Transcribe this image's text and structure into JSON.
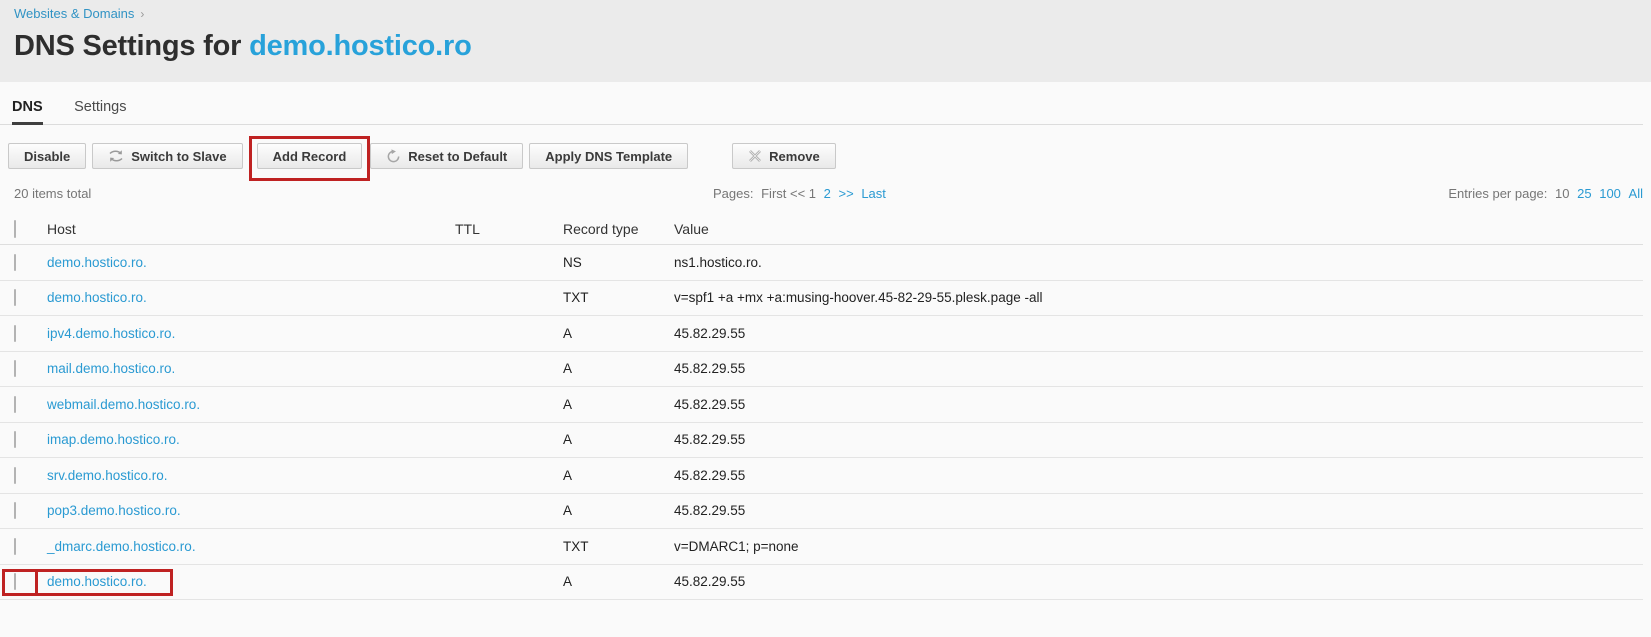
{
  "colors": {
    "highlight_red": "#bf2222",
    "link_blue": "#2a9ad2",
    "title_blue": "#28a2da",
    "header_band": "#ebebeb"
  },
  "breadcrumb": {
    "label": "Websites & Domains",
    "separator": "›"
  },
  "page": {
    "title_prefix": "DNS Settings for ",
    "domain": "demo.hostico.ro"
  },
  "tabs": [
    {
      "label": "DNS",
      "active": true
    },
    {
      "label": "Settings",
      "active": false
    }
  ],
  "toolbar": {
    "buttons": [
      {
        "label": "Disable",
        "icon": ""
      },
      {
        "label": "Switch to Slave",
        "icon": "swap-icon"
      },
      {
        "label": "Add Record",
        "icon": "",
        "highlighted": true
      },
      {
        "label": "Reset to Default",
        "icon": "refresh-icon"
      },
      {
        "label": "Apply DNS Template",
        "icon": ""
      },
      {
        "label": "Remove",
        "icon": "cross-icon"
      }
    ]
  },
  "list_info": {
    "total": "20 items total",
    "pages_label": "Pages:",
    "pages_static": "First << 1",
    "page_links": [
      "2",
      ">>",
      "Last"
    ],
    "entries_label": "Entries per page:",
    "entries_current": "10",
    "entries_links": [
      "25",
      "100",
      "All"
    ]
  },
  "table": {
    "columns": [
      "Host",
      "TTL",
      "Record type",
      "Value"
    ],
    "rows": [
      {
        "host": "demo.hostico.ro.",
        "ttl": "",
        "type": "NS",
        "value": "ns1.hostico.ro.",
        "highlighted": false
      },
      {
        "host": "demo.hostico.ro.",
        "ttl": "",
        "type": "TXT",
        "value": "v=spf1 +a +mx +a:musing-hoover.45-82-29-55.plesk.page -all",
        "highlighted": false
      },
      {
        "host": "ipv4.demo.hostico.ro.",
        "ttl": "",
        "type": "A",
        "value": "45.82.29.55",
        "highlighted": false
      },
      {
        "host": "mail.demo.hostico.ro.",
        "ttl": "",
        "type": "A",
        "value": "45.82.29.55",
        "highlighted": false
      },
      {
        "host": "webmail.demo.hostico.ro.",
        "ttl": "",
        "type": "A",
        "value": "45.82.29.55",
        "highlighted": false
      },
      {
        "host": "imap.demo.hostico.ro.",
        "ttl": "",
        "type": "A",
        "value": "45.82.29.55",
        "highlighted": false
      },
      {
        "host": "srv.demo.hostico.ro.",
        "ttl": "",
        "type": "A",
        "value": "45.82.29.55",
        "highlighted": false
      },
      {
        "host": "pop3.demo.hostico.ro.",
        "ttl": "",
        "type": "A",
        "value": "45.82.29.55",
        "highlighted": false
      },
      {
        "host": "_dmarc.demo.hostico.ro.",
        "ttl": "",
        "type": "TXT",
        "value": "v=DMARC1; p=none",
        "highlighted": false
      },
      {
        "host": "demo.hostico.ro.",
        "ttl": "",
        "type": "A",
        "value": "45.82.29.55",
        "highlighted": true
      }
    ]
  }
}
